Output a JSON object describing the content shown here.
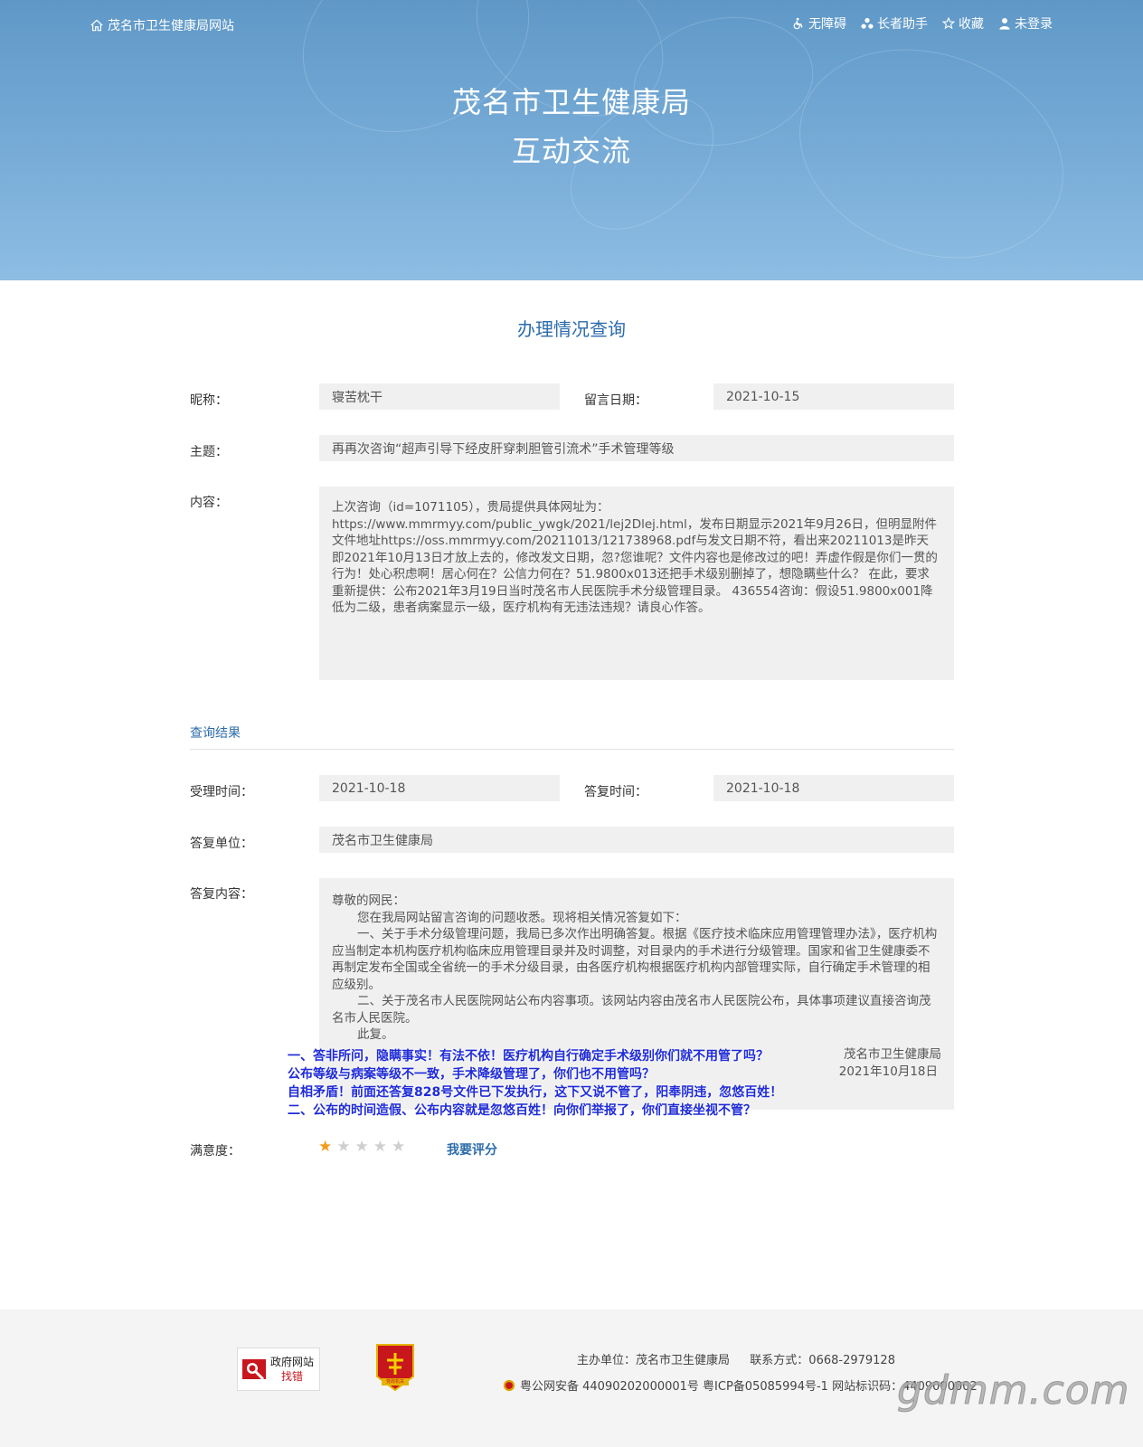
{
  "header": {
    "site_link": "茂名市卫生健康局网站",
    "accessibility": "无障碍",
    "elder_assist": "长者助手",
    "favorite": "收藏",
    "login": "未登录",
    "title_line1": "茂名市卫生健康局",
    "title_line2": "互动交流"
  },
  "page": {
    "section_title": "办理情况查询"
  },
  "form": {
    "nickname_label": "昵称：",
    "nickname": "寝苦枕干",
    "date_label": "留言日期：",
    "date": "2021-10-15",
    "subject_label": "主题：",
    "subject": "再再次咨询“超声引导下经皮肝穿刺胆管引流术”手术管理等级",
    "content_label": "内容：",
    "content": "上次咨询（id=1071105），贵局提供具体网址为：https://www.mmrmyy.com/public_ywgk/2021/lej2Dlej.html，发布日期显示2021年9月26日，但明显附件文件地址https://oss.mmrmyy.com/20211013/121738968.pdf与发文日期不符，看出来20211013是昨天即2021年10月13日才放上去的，修改发文日期，忽?您谁呢？文件内容也是修改过的吧！弄虚作假是你们一贯的行为！处心积虑啊！居心何在？公信力何在？51.9800x013还把手术级别删掉了，想隐瞒些什么？ 在此，要求重新提供：公布2021年3月19日当时茂名市人民医院手术分级管理目录。 436554咨询：假设51.9800x001降低为二级，患者病案显示一级，医疗机构有无违法违规？请良心作答。"
  },
  "result": {
    "heading": "查询结果",
    "accept_label": "受理时间：",
    "accept_time": "2021-10-18",
    "reply_time_label": "答复时间：",
    "reply_time": "2021-10-18",
    "unit_label": "答复单位：",
    "unit": "茂名市卫生健康局",
    "reply_label": "答复内容：",
    "reply_lines": [
      "尊敬的网民：",
      "您在我局网站留言咨询的问题收悉。现将相关情况答复如下：",
      "一、关于手术分级管理问题，我局已多次作出明确答复。根据《医疗技术临床应用管理管理办法》，医疗机构应当制定本机构医疗机构临床应用管理目录并及时调整，对目录内的手术进行分级管理。国家和省卫生健康委不再制定发布全国或全省统一的手术分级目录，由各医疗机构根据医疗机构内部管理实际，自行确定手术管理的相应级别。",
      "二、关于茂名市人民医院网站公布内容事项。该网站内容由茂名市人民医院公布，具体事项建议直接咨询茂名市人民医院。",
      "此复。"
    ],
    "sign_org": "茂名市卫生健康局",
    "sign_date": "2021年10月18日",
    "annotation": [
      "一、答非所问，隐瞒事实！有法不依！医疗机构自行确定手术级别你们就不用管了吗？",
      "公布等级与病案等级不一致，手术降级管理了，你们也不用管吗？",
      "自相矛盾！前面还答复828号文件已下发执行，这下又说不管了，阳奉阴违，忽悠百姓！",
      "二、公布的时间造假、公布内容就是忽悠百姓！向你们举报了，你们直接坐视不管？"
    ],
    "satisfaction_label": "满意度：",
    "rating": 1,
    "rating_max": 5,
    "rate_button": "我要评分"
  },
  "footer": {
    "gov_badge_line1": "政府网站",
    "gov_badge_line2": "找错",
    "party_badge": "党政机关",
    "host": "主办单位：茂名市卫生健康局",
    "contact": "联系方式：0668-2979128",
    "record": "粤公网安备 44090202000001号 粤ICP备05085994号-1 网站标识码：4409000002",
    "watermark": "gdmm.com"
  },
  "colors": {
    "banner": "#6aa2d0",
    "accent": "#2d6cab",
    "field_bg": "#f0f0f0",
    "annotation": "#1f2bd8",
    "star_on": "#f29b1a",
    "star_off": "#cfcfcf"
  }
}
